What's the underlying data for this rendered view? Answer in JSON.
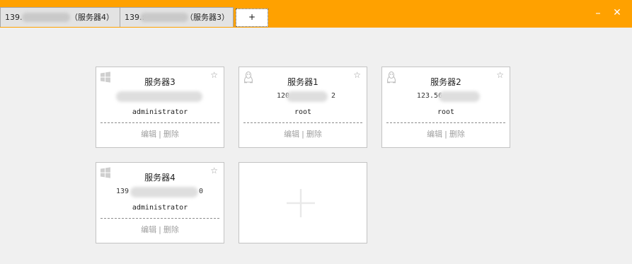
{
  "window": {
    "minimize_label": "–",
    "close_label": "✕"
  },
  "tabs": [
    {
      "ip": "139.",
      "name": "（服务器4）"
    },
    {
      "ip": "139.:",
      "name": "（服务器3）"
    }
  ],
  "add_tab_label": "+",
  "servers": [
    {
      "name": "服务器3",
      "os": "windows",
      "ip": "",
      "user": "administrator"
    },
    {
      "name": "服务器1",
      "os": "linux",
      "ip": "120.",
      "ip_tail": "2",
      "user": "root"
    },
    {
      "name": "服务器2",
      "os": "linux",
      "ip": "123.56.",
      "user": "root"
    },
    {
      "name": "服务器4",
      "os": "windows",
      "ip": "139",
      "ip_tail": "0",
      "user": "administrator"
    }
  ],
  "actions": {
    "edit": "编辑",
    "separator": "|",
    "delete": "删除"
  },
  "icons": {
    "windows": "windows-icon",
    "linux": "linux-penguin-icon",
    "favorite": "star-icon",
    "add_server": "plus-icon"
  },
  "colors": {
    "titlebar": "#ffa100",
    "background": "#f0f0f0",
    "card": "#ffffff",
    "muted_text": "#a0a0a0"
  }
}
